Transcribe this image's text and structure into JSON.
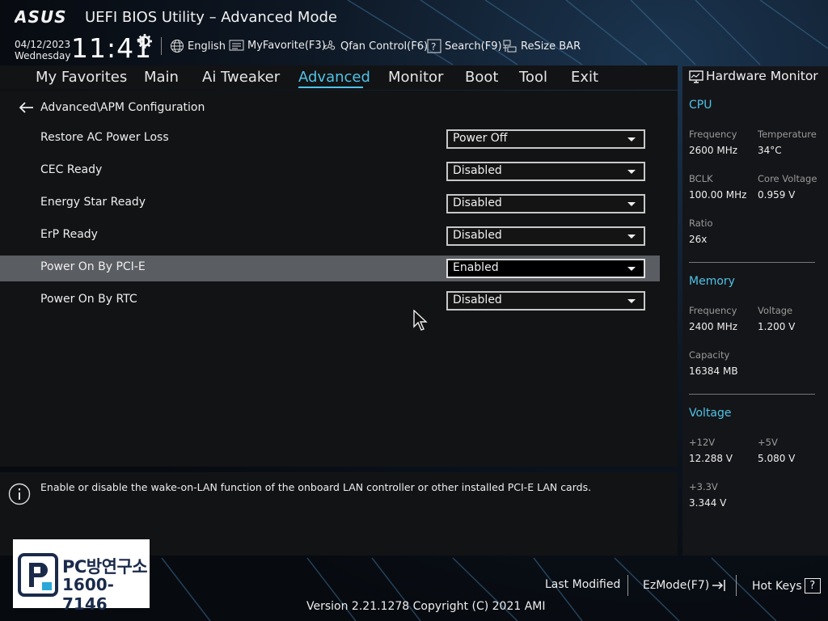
{
  "header": {
    "title": "UEFI BIOS Utility – Advanced Mode",
    "date": "04/12/2023",
    "day": "Wednesday",
    "time": "11:41",
    "toolbar": [
      {
        "label": "English",
        "icon": "globe-icon"
      },
      {
        "label": "MyFavorite(F3)",
        "icon": "favorite-icon"
      },
      {
        "label": "Qfan Control(F6)",
        "icon": "fan-icon"
      },
      {
        "label": "Search(F9)",
        "icon": "search-help-icon"
      },
      {
        "label": "ReSize BAR",
        "icon": "resize-bar-icon"
      }
    ]
  },
  "menu": {
    "items": [
      "My Favorites",
      "Main",
      "Ai Tweaker",
      "Advanced",
      "Monitor",
      "Boot",
      "Tool",
      "Exit"
    ],
    "active": "Advanced"
  },
  "breadcrumb": "Advanced\\APM Configuration",
  "settings": [
    {
      "label": "Restore AC Power Loss",
      "value": "Power Off"
    },
    {
      "label": "CEC Ready",
      "value": "Disabled"
    },
    {
      "label": "Energy Star Ready",
      "value": "Disabled"
    },
    {
      "label": "ErP Ready",
      "value": "Disabled"
    },
    {
      "label": "Power On By PCI-E",
      "value": "Enabled"
    },
    {
      "label": "Power On By RTC",
      "value": "Disabled"
    }
  ],
  "help_text": "Enable or disable the wake-on-LAN function of the onboard LAN controller or other installed PCI-E LAN cards.",
  "hardware_monitor": {
    "title": "Hardware Monitor",
    "cpu": {
      "heading": "CPU",
      "frequency_label": "Frequency",
      "frequency": "2600 MHz",
      "temperature_label": "Temperature",
      "temperature": "34°C",
      "bclk_label": "BCLK",
      "bclk": "100.00 MHz",
      "core_voltage_label": "Core Voltage",
      "core_voltage": "0.959 V",
      "ratio_label": "Ratio",
      "ratio": "26x"
    },
    "memory": {
      "heading": "Memory",
      "frequency_label": "Frequency",
      "frequency": "2400 MHz",
      "voltage_label": "Voltage",
      "voltage": "1.200 V",
      "capacity_label": "Capacity",
      "capacity": "16384 MB"
    },
    "voltage": {
      "heading": "Voltage",
      "v12_label": "+12V",
      "v12": "12.288 V",
      "v5_label": "+5V",
      "v5": "5.080 V",
      "v33_label": "+3.3V",
      "v33": "3.344 V"
    }
  },
  "footer": {
    "last_modified": "Last Modified",
    "ezmode": "EzMode(F7)",
    "hotkeys": "Hot Keys",
    "hotkeys_key": "?",
    "version": "Version 2.21.1278 Copyright (C) 2021 AMI"
  },
  "brand": {
    "name": "PC방연구소",
    "phone": "1600-7146"
  },
  "colors": {
    "accent": "#4fc3e8",
    "panel": "#121315",
    "highlight_row": "#5a5d62"
  }
}
